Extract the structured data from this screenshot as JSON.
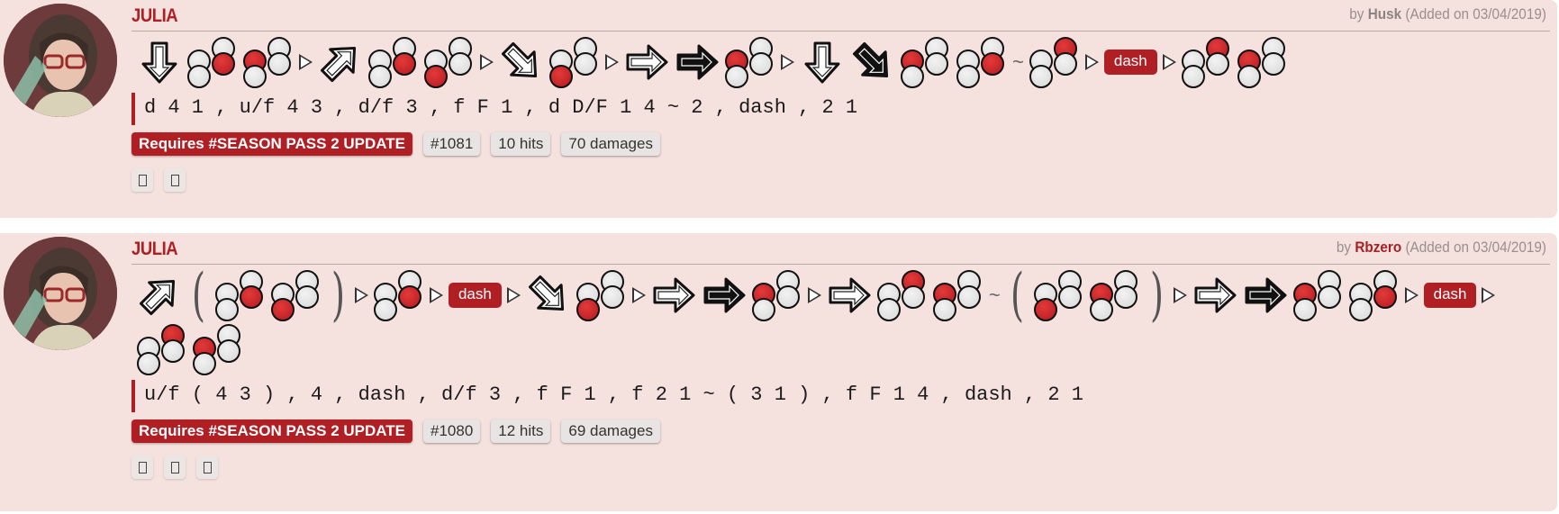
{
  "colors": {
    "accent": "#b01f24",
    "card_bg": "#f5e1dd",
    "tag_bg": "#e8e4e3"
  },
  "combos": [
    {
      "character": "JULIA",
      "author_prefix": "by",
      "author": "Husk",
      "added": "(Added on 03/04/2019)",
      "inputs": [
        {
          "t": "dir",
          "name": "down-arrow-icon",
          "dir": "d",
          "hold": false
        },
        {
          "t": "btn",
          "on": [
            4
          ]
        },
        {
          "t": "btn",
          "on": [
            1
          ]
        },
        {
          "t": "next"
        },
        {
          "t": "dir",
          "name": "up-forward-arrow-icon",
          "dir": "uf",
          "hold": false
        },
        {
          "t": "btn",
          "on": [
            4
          ]
        },
        {
          "t": "btn",
          "on": [
            3
          ]
        },
        {
          "t": "next"
        },
        {
          "t": "dir",
          "name": "down-forward-arrow-icon",
          "dir": "df",
          "hold": false
        },
        {
          "t": "btn",
          "on": [
            3
          ]
        },
        {
          "t": "next"
        },
        {
          "t": "dir",
          "name": "forward-arrow-icon",
          "dir": "f",
          "hold": false
        },
        {
          "t": "dir",
          "name": "forward-hold-arrow-icon",
          "dir": "f",
          "hold": true
        },
        {
          "t": "btn",
          "on": [
            1
          ]
        },
        {
          "t": "next"
        },
        {
          "t": "dir",
          "name": "down-arrow-icon",
          "dir": "d",
          "hold": false
        },
        {
          "t": "dir",
          "name": "down-forward-hold-arrow-icon",
          "dir": "df",
          "hold": true
        },
        {
          "t": "btn",
          "on": [
            1
          ]
        },
        {
          "t": "btn",
          "on": [
            4
          ]
        },
        {
          "t": "tilde",
          "text": "~"
        },
        {
          "t": "btn",
          "on": [
            2
          ]
        },
        {
          "t": "next"
        },
        {
          "t": "dash",
          "text": "dash"
        },
        {
          "t": "next"
        },
        {
          "t": "btn",
          "on": [
            2
          ]
        },
        {
          "t": "btn",
          "on": [
            1
          ]
        }
      ],
      "notation": "d 4 1 , u/f 4 3 , d/f 3 , f F 1 , d D/F 1 4 ~ 2 , dash , 2 1",
      "requirement": "Requires #SEASON PASS 2 UPDATE",
      "id": "#1081",
      "hits": "10 hits",
      "damage": "70 damages",
      "action_count": 2
    },
    {
      "character": "JULIA",
      "author_prefix": "by",
      "author": "Rbzero",
      "added": "(Added on 03/04/2019)",
      "inputs": [
        {
          "t": "dir",
          "name": "up-forward-arrow-icon",
          "dir": "uf",
          "hold": false
        },
        {
          "t": "paren",
          "text": "("
        },
        {
          "t": "btn",
          "on": [
            4
          ]
        },
        {
          "t": "btn",
          "on": [
            3
          ]
        },
        {
          "t": "paren",
          "text": ")"
        },
        {
          "t": "next"
        },
        {
          "t": "btn",
          "on": [
            4
          ]
        },
        {
          "t": "next"
        },
        {
          "t": "dash",
          "text": "dash"
        },
        {
          "t": "next"
        },
        {
          "t": "dir",
          "name": "down-forward-arrow-icon",
          "dir": "df",
          "hold": false
        },
        {
          "t": "btn",
          "on": [
            3
          ]
        },
        {
          "t": "next"
        },
        {
          "t": "dir",
          "name": "forward-arrow-icon",
          "dir": "f",
          "hold": false
        },
        {
          "t": "dir",
          "name": "forward-hold-arrow-icon",
          "dir": "f",
          "hold": true
        },
        {
          "t": "btn",
          "on": [
            1
          ]
        },
        {
          "t": "next"
        },
        {
          "t": "dir",
          "name": "forward-arrow-icon",
          "dir": "f",
          "hold": false
        },
        {
          "t": "btn",
          "on": [
            2
          ]
        },
        {
          "t": "btn",
          "on": [
            1
          ]
        },
        {
          "t": "tilde",
          "text": "~"
        },
        {
          "t": "paren",
          "text": "("
        },
        {
          "t": "btn",
          "on": [
            3
          ]
        },
        {
          "t": "btn",
          "on": [
            1
          ]
        },
        {
          "t": "paren",
          "text": ")"
        },
        {
          "t": "next"
        },
        {
          "t": "dir",
          "name": "forward-arrow-icon",
          "dir": "f",
          "hold": false
        },
        {
          "t": "dir",
          "name": "forward-hold-arrow-icon",
          "dir": "f",
          "hold": true
        },
        {
          "t": "btn",
          "on": [
            1
          ]
        },
        {
          "t": "btn",
          "on": [
            4
          ]
        },
        {
          "t": "next"
        },
        {
          "t": "dash",
          "text": "dash"
        },
        {
          "t": "next"
        },
        {
          "t": "btn",
          "on": [
            2
          ]
        },
        {
          "t": "btn",
          "on": [
            1
          ]
        }
      ],
      "notation": "u/f ( 4 3 ) , 4 , dash , d/f 3 , f F 1 , f 2 1 ~ ( 3 1 ) , f F 1 4 , dash , 2 1",
      "requirement": "Requires #SEASON PASS 2 UPDATE",
      "id": "#1080",
      "hits": "12 hits",
      "damage": "69 damages",
      "action_count": 3
    }
  ]
}
